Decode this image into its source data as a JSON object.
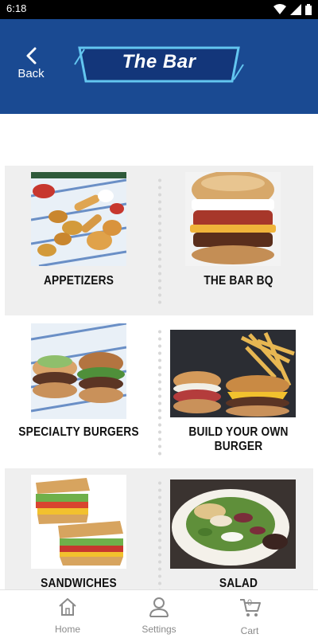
{
  "status": {
    "time": "6:18"
  },
  "header": {
    "back_label": "Back",
    "logo_text": "The Bar"
  },
  "categories": [
    {
      "label": "APPETIZERS"
    },
    {
      "label": "THE BAR BQ"
    },
    {
      "label": "SPECIALTY BURGERS"
    },
    {
      "label": "BUILD YOUR OWN BURGER"
    },
    {
      "label": "SANDWICHES"
    },
    {
      "label": "SALAD"
    }
  ],
  "tabbar": {
    "home": "Home",
    "settings": "Settings",
    "cart": "Cart",
    "cart_count": "0"
  },
  "colors": {
    "header": "#1a4a92",
    "accent": "#63c6f0"
  }
}
